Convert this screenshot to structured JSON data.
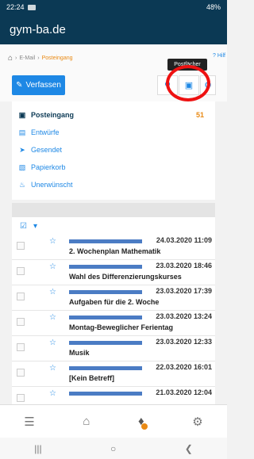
{
  "status_bar": {
    "time": "22:24",
    "battery": "48%"
  },
  "app": {
    "title": "gym-ba.de"
  },
  "breadcrumb": {
    "items": [
      "E-Mail",
      "Posteingang"
    ],
    "help": "Hilf"
  },
  "tooltip": {
    "text": "Postfächer"
  },
  "toolbar": {
    "compose_label": "Verfassen"
  },
  "folders": [
    {
      "label": "Posteingang",
      "count": "51",
      "icon": "inbox-icon"
    },
    {
      "label": "Entwürfe",
      "count": "",
      "icon": "drafts-icon"
    },
    {
      "label": "Gesendet",
      "count": "",
      "icon": "send-icon"
    },
    {
      "label": "Papierkorb",
      "count": "",
      "icon": "trash-icon"
    },
    {
      "label": "Unerwünscht",
      "count": "",
      "icon": "spam-icon"
    }
  ],
  "mails": [
    {
      "date": "24.03.2020 11:09",
      "subject": "2. Wochenplan Mathematik"
    },
    {
      "date": "23.03.2020 18:46",
      "subject": "Wahl des Differenzierungskurses"
    },
    {
      "date": "23.03.2020 17:39",
      "subject": "Aufgaben für die 2. Woche"
    },
    {
      "date": "23.03.2020 13:24",
      "subject": "Montag-Beweglicher Ferientag"
    },
    {
      "date": "23.03.2020 12:33",
      "subject": "Musik"
    },
    {
      "date": "22.03.2020 16:01",
      "subject": "[Kein Betreff]"
    },
    {
      "date": "21.03.2020 12:04",
      "subject": ""
    }
  ],
  "colors": {
    "primary": "#0b3954",
    "accent": "#1e88e5",
    "highlight": "#e98a15",
    "annotation": "#e11111"
  }
}
